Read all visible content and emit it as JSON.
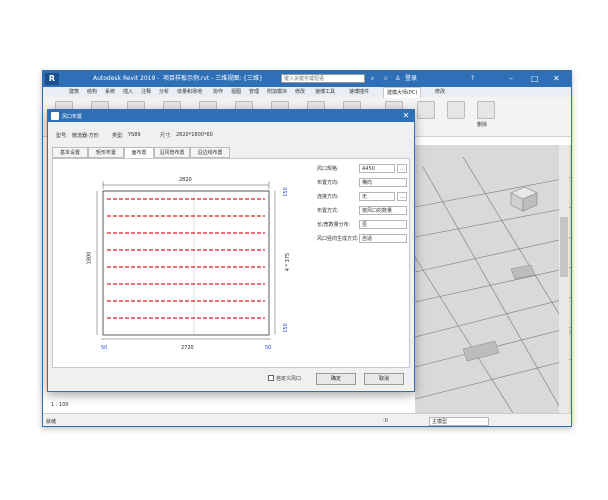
{
  "app": {
    "logo": "R",
    "title": "Autodesk Revit 2019 -",
    "doc_title": "项目样板示例.rvt - 三维视图: {三维}",
    "search_placeholder": "键入关键字或短语",
    "user": "登录",
    "window_controls": [
      "–",
      "□",
      "✕"
    ]
  },
  "ribbon": {
    "tabs": [
      "建筑",
      "结构",
      "系统",
      "插入",
      "注释",
      "分析",
      "体量和场地",
      "协作",
      "视图",
      "管理",
      "附加模块",
      "修改",
      "速博工具",
      "速博插件",
      "建模大师(PC)",
      "修改"
    ],
    "active_tab": "建模大师(PC)",
    "tools": [
      "",
      "",
      "",
      "",
      "",
      "",
      "",
      "",
      "",
      "",
      "",
      "",
      ""
    ],
    "tool_labels": [
      "",
      "",
      "",
      "删除"
    ]
  },
  "statusbar": {
    "left_text": "就绪",
    "scale": "1 : 100",
    "zoom": ":0",
    "model": "主模型"
  },
  "dialog": {
    "title": "风口布置",
    "info_label_name": "型号:",
    "info_value_name": "散流器-方形",
    "info_label_type": "类型:",
    "info_value_type": "YS89",
    "info_label_size": "尺寸:",
    "info_value_size": "2820*1800*60",
    "tabs": [
      "基本设置",
      "矩形布置",
      "面布置",
      "沿风管布置",
      "沿边线布置"
    ],
    "active_tab": "面布置",
    "settings": [
      {
        "label": "风口规格:",
        "value": "A450"
      },
      {
        "label": "布置方向:",
        "value": "横向"
      },
      {
        "label": "连接方向:",
        "value": "无"
      },
      {
        "label": "布置方式:",
        "value": "按风口的数量"
      },
      {
        "label": "长/宽数量分布:",
        "value": "否"
      },
      {
        "label": "风口竖向生成方式:",
        "value": "自适"
      }
    ],
    "drawing": {
      "width_label": "2820",
      "height_label": "1800",
      "bottom_left": "50",
      "bottom_mid": "2720",
      "bottom_right": "50",
      "right_label": "4 * 375",
      "top_right": "150",
      "bottom_right_v": "150",
      "center_mark": "4"
    },
    "checkbox_label": "自定义风口",
    "ok": "确定",
    "cancel": "取消"
  }
}
